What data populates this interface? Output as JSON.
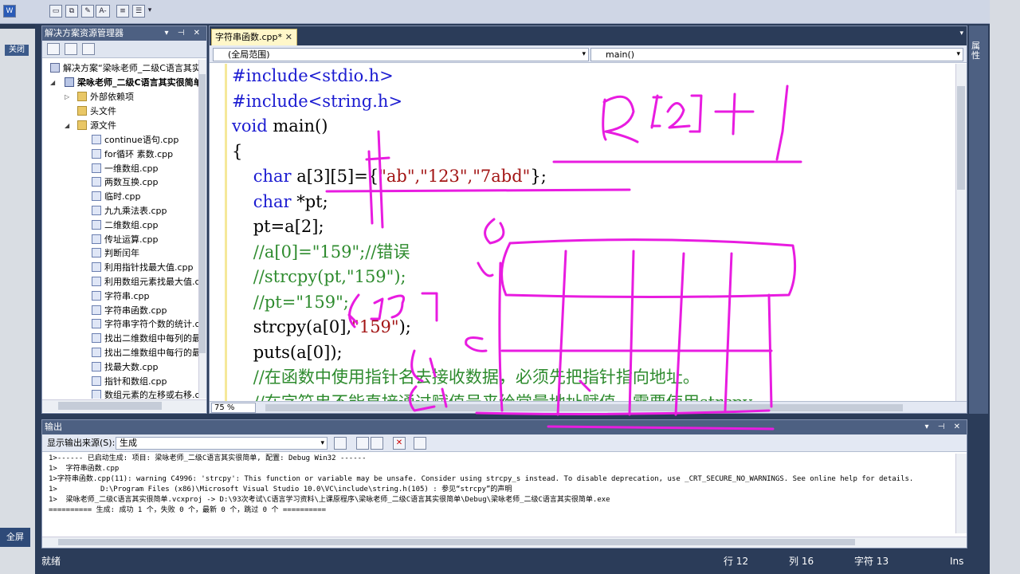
{
  "colors": {
    "ink": "#e81ce0",
    "keyword": "#1b1bd1",
    "string": "#a31515",
    "comment": "#2e8b2e"
  },
  "left_strip": {
    "close": "关闭",
    "fullscreen": "全屏"
  },
  "toolbar": {
    "label": "A-"
  },
  "solution_explorer": {
    "title": "解决方案资源管理器",
    "solution": "解决方案“梁咏老师_二级C语言其实",
    "project": "梁咏老师_二级C语言其实很简单",
    "folders": [
      "外部依赖项",
      "头文件",
      "源文件"
    ],
    "files": [
      "continue语句.cpp",
      "for循环 素数.cpp",
      "一维数组.cpp",
      "两数互换.cpp",
      "临时.cpp",
      "九九乘法表.cpp",
      "二维数组.cpp",
      "传址运算.cpp",
      "判断闰年",
      "利用指针找最大值.cpp",
      "利用数组元素找最大值.c",
      "字符串.cpp",
      "字符串函数.cpp",
      "字符串字符个数的统计.c",
      "找出二维数组中每列的最",
      "找出二维数组中每行的最",
      "找最大数.cpp",
      "指针和数组.cpp",
      "数组元素的左移或右移.c"
    ]
  },
  "editor": {
    "tab": "字符串函数.cpp*",
    "scope": "(全局范围)",
    "member": "main()",
    "zoom": "75 %",
    "lines": [
      {
        "t": "#include<stdio.h>",
        "cls": "kw"
      },
      {
        "t": "#include<string.h>",
        "cls": "kw"
      },
      {
        "kw": "void",
        "t": " main()"
      },
      {
        "t": "{"
      },
      {
        "kw": "    char",
        "t": " a[3][5]={",
        "s": "\"ab\",\"123\",\"7abd\"",
        "e": "};"
      },
      {
        "kw": "    char",
        "t": " *pt;"
      },
      {
        "t": "    pt=a[2];"
      },
      {
        "c": "    //a[0]=\"159\";//错误"
      },
      {
        "c": "    //strcpy(pt,\"159\");"
      },
      {
        "c": "    //pt=\"159\";"
      },
      {
        "t": "    strcpy(a[0],",
        "s": "\"159\"",
        "e": ");"
      },
      {
        "t": "    puts(a[0]);"
      },
      {
        "c": "    //在函数中使用指针名去接收数据，必须先把指针指向地址。"
      },
      {
        "c": "    //在字符串不能直接通过赋值号来给常量地址赋值，需要使用strcpy"
      }
    ]
  },
  "right_panel": {
    "label": "属性"
  },
  "output": {
    "title": "输出",
    "source_label": "显示输出来源(S):",
    "source_value": "生成",
    "lines": [
      "1>------ 已启动生成: 项目: 梁咏老师_二级C语言其实很简单, 配置: Debug Win32 ------",
      "1>  字符串函数.cpp",
      "1>字符串函数.cpp(11): warning C4996: 'strcpy': This function or variable may be unsafe. Consider using strcpy_s instead. To disable deprecation, use _CRT_SECURE_NO_WARNINGS. See online help for details.",
      "1>          D:\\Program Files (x86)\\Microsoft Visual Studio 10.0\\VC\\include\\string.h(105) : 参见“strcpy”的声明",
      "1>  梁咏老师_二级C语言其实很简单.vcxproj -> D:\\93次考试\\C语言学习资料\\上课原程序\\梁咏老师_二级C语言其实很简单\\Debug\\梁咏老师_二级C语言其实很简单.exe",
      "========== 生成: 成功 1 个，失败 0 个，最新 0 个，跳过 0 个 =========="
    ]
  },
  "status": {
    "ready": "就绪",
    "line": "行 12",
    "col": "列 16",
    "char": "字符 13",
    "mode": "Ins"
  }
}
